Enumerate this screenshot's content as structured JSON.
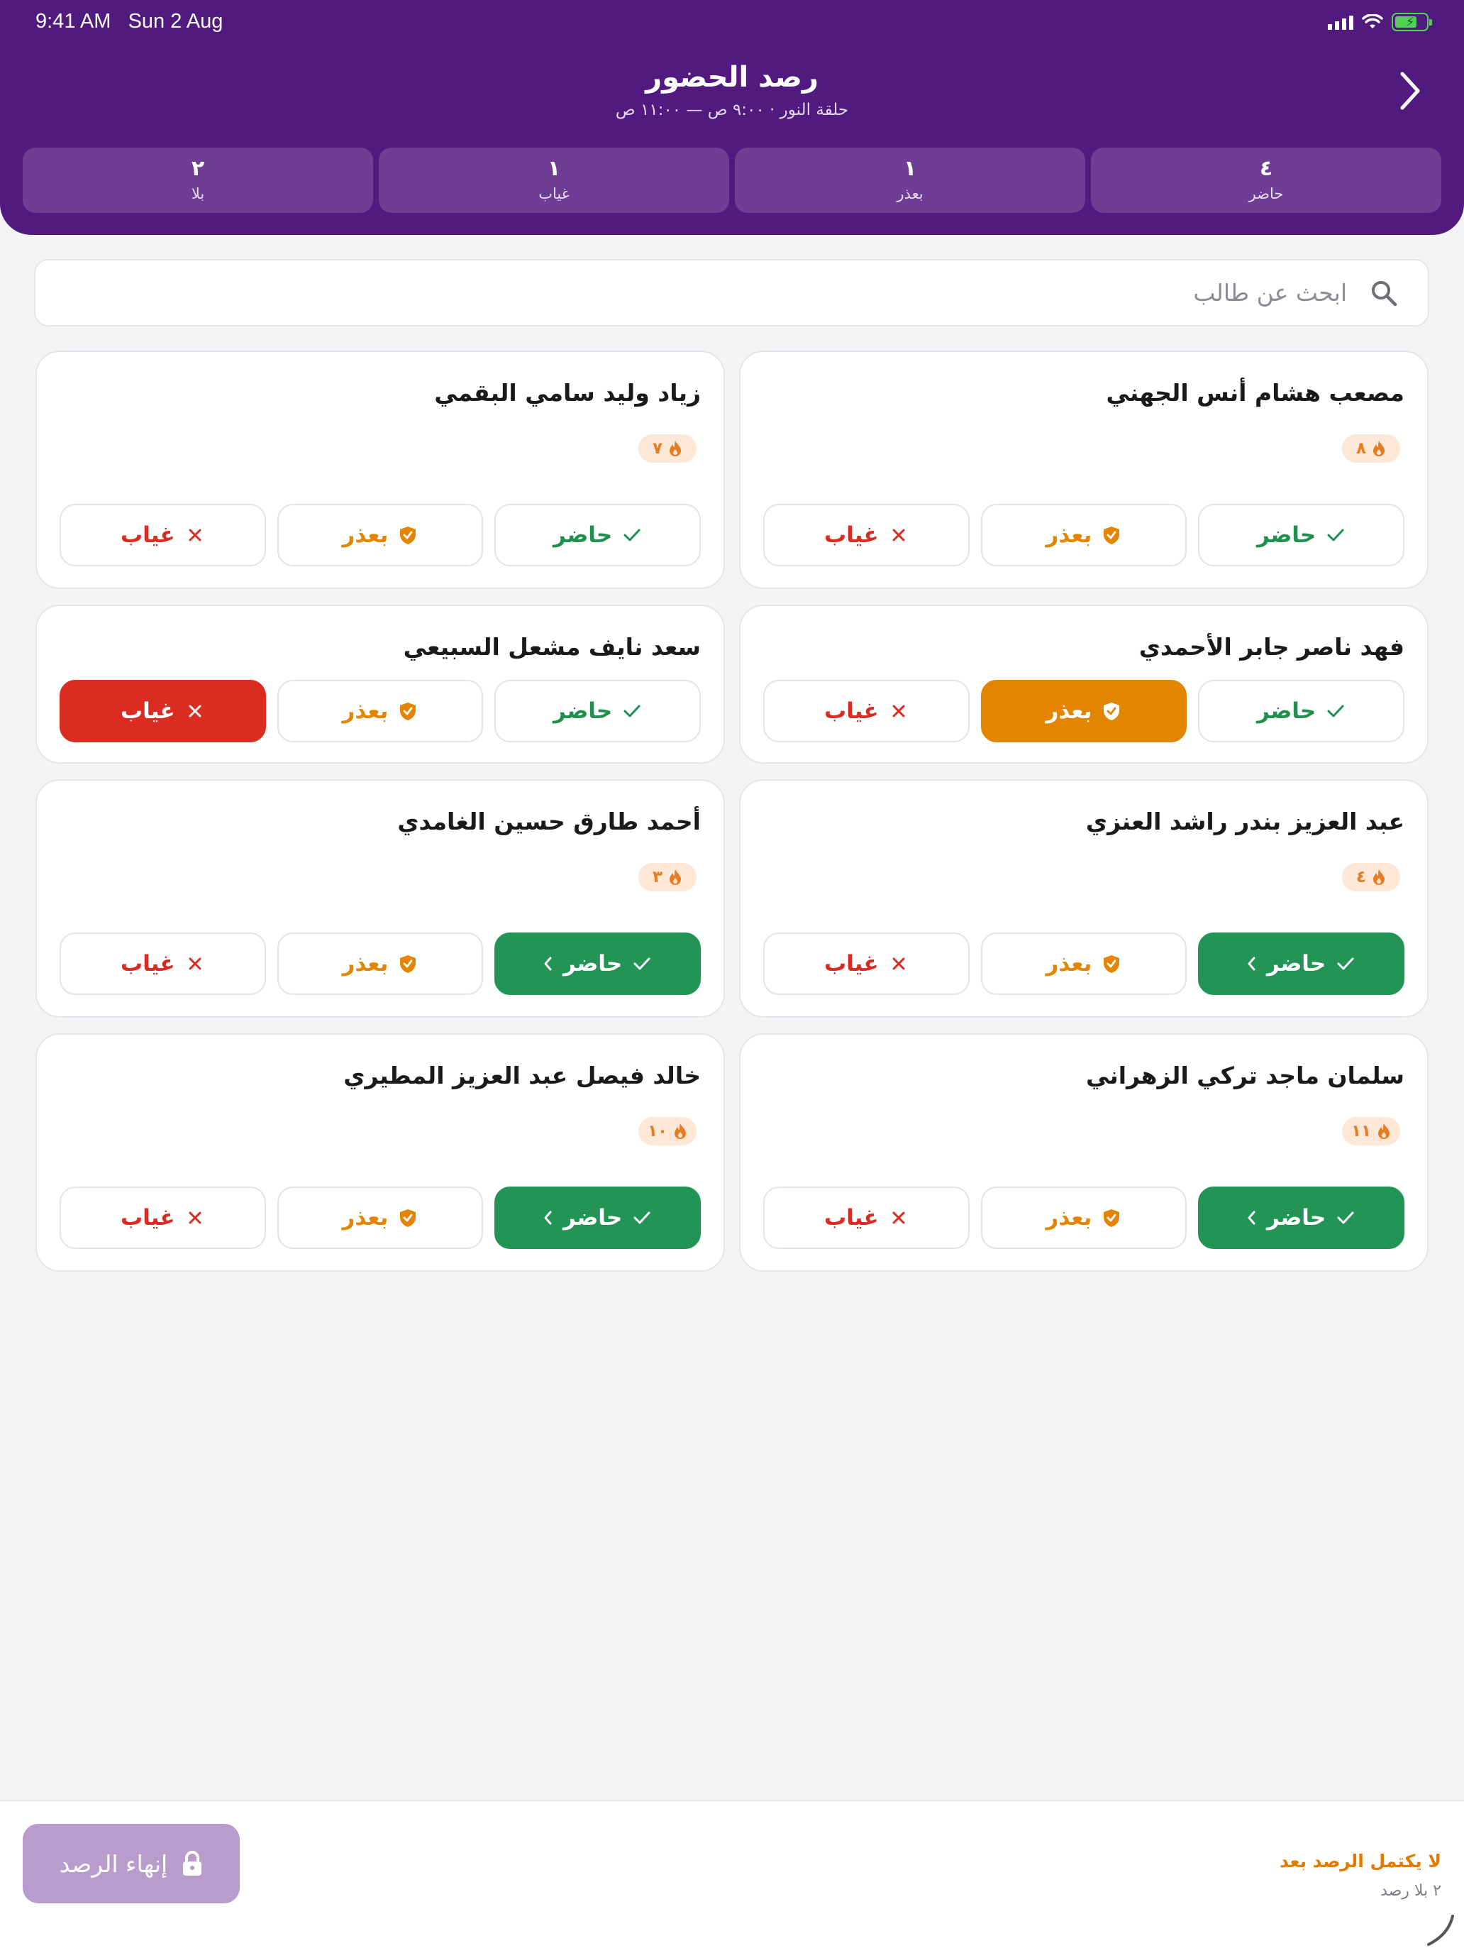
{
  "status": {
    "time": "9:41 AM",
    "date": "Sun 2 Aug"
  },
  "header": {
    "title": "رصد الحضور",
    "subtitle": "حلقة النور · ٩:٠٠ ص — ١١:٠٠ ص",
    "back_icon": "chevron-right-icon"
  },
  "stats": [
    {
      "value": "٤",
      "label": "حاضر"
    },
    {
      "value": "١",
      "label": "بعذر"
    },
    {
      "value": "١",
      "label": "غياب"
    },
    {
      "value": "٢",
      "label": "بلا"
    }
  ],
  "search": {
    "placeholder": "ابحث عن طالب",
    "value": ""
  },
  "buttons": {
    "present": "حاضر",
    "excused": "بعذر",
    "absent": "غياب"
  },
  "students": [
    {
      "name": "مصعب هشام أنس الجهني",
      "streak": "٨",
      "status": "none"
    },
    {
      "name": "زياد وليد سامي البقمي",
      "streak": "٧",
      "status": "none"
    },
    {
      "name": "فهد ناصر جابر الأحمدي",
      "streak": "",
      "status": "excused"
    },
    {
      "name": "سعد نايف مشعل السبيعي",
      "streak": "",
      "status": "absent"
    },
    {
      "name": "عبد العزيز بندر راشد العنزي",
      "streak": "٤",
      "status": "present"
    },
    {
      "name": "أحمد طارق حسين الغامدي",
      "streak": "٣",
      "status": "present"
    },
    {
      "name": "سلمان ماجد تركي الزهراني",
      "streak": "١١",
      "status": "present"
    },
    {
      "name": "خالد فيصل عبد العزيز المطيري",
      "streak": "١٠",
      "status": "present"
    }
  ],
  "footer": {
    "finish_label": "إنهاء الرصد",
    "warning_title": "لا يكتمل الرصد بعد",
    "warning_sub": "٢ بلا رصد"
  },
  "colors": {
    "header_bg": "#511a7f",
    "present": "#229455",
    "excused": "#e28500",
    "absent": "#da2c21",
    "finish_disabled": "#b89ccc"
  }
}
